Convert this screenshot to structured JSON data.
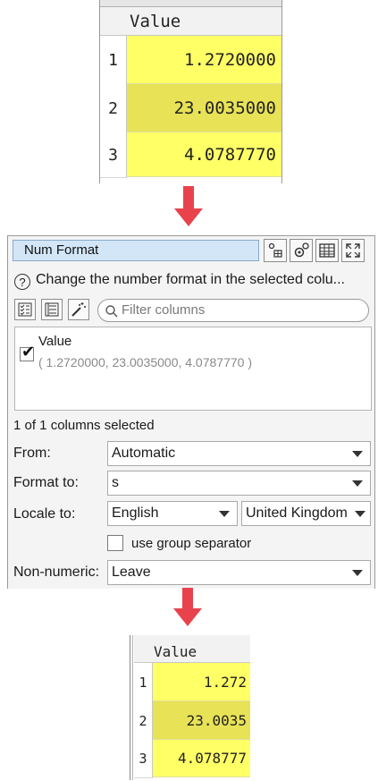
{
  "top_table": {
    "header": "Value",
    "rows": [
      {
        "num": "1",
        "value": "1.2720000"
      },
      {
        "num": "2",
        "value": "23.0035000"
      },
      {
        "num": "3",
        "value": "4.0787770"
      }
    ]
  },
  "panel": {
    "title": "Num Format",
    "description": "Change the number format in the selected colu...",
    "help_glyph": "?",
    "filter_placeholder": "Filter columns",
    "column": {
      "name": "Value",
      "checked": true,
      "preview": "( 1.2720000, 23.0035000, 4.0787770 )"
    },
    "selected_count": "1 of 1 columns selected",
    "from_label": "From:",
    "from_value": "Automatic",
    "format_to_label": "Format to:",
    "format_to_value": "s",
    "locale_to_label": "Locale to:",
    "locale_language": "English",
    "locale_country": "United Kingdom",
    "group_separator_label": "use group separator",
    "group_separator_checked": false,
    "non_numeric_label": "Non-numeric:",
    "non_numeric_value": "Leave"
  },
  "bottom_table": {
    "header": "Value",
    "rows": [
      {
        "num": "1",
        "value": "1.272"
      },
      {
        "num": "2",
        "value": "23.0035"
      },
      {
        "num": "3",
        "value": "4.078777"
      }
    ]
  },
  "colors": {
    "arrow": "#e8434d",
    "cell_yellow": "#ffff66",
    "cell_yellow_selected": "#e8e256",
    "title_field": "#d3e6f7"
  }
}
